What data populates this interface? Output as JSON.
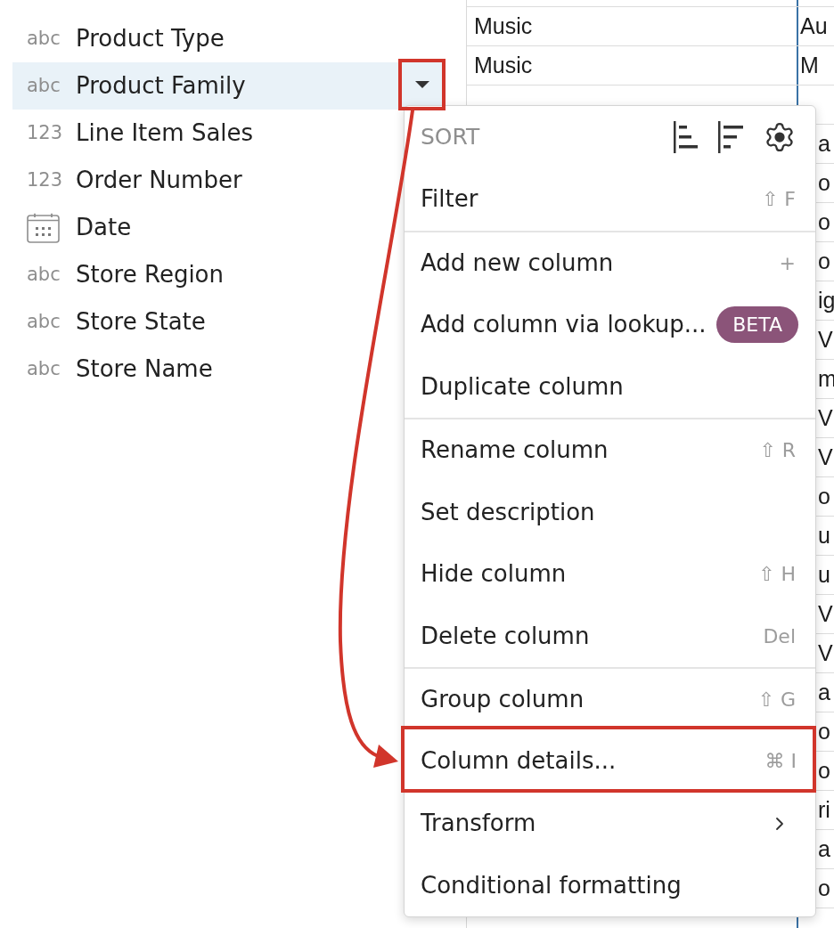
{
  "fields": [
    {
      "kind": "text",
      "type_label": "abc",
      "label": "Product Type",
      "selected": false
    },
    {
      "kind": "text",
      "type_label": "abc",
      "label": "Product Family",
      "selected": true,
      "callout": true
    },
    {
      "kind": "number",
      "type_label": "123",
      "label": "Line Item Sales",
      "selected": false
    },
    {
      "kind": "number",
      "type_label": "123",
      "label": "Order Number",
      "selected": false
    },
    {
      "kind": "date",
      "label": "Date",
      "selected": false
    },
    {
      "kind": "text",
      "type_label": "abc",
      "label": "Store Region",
      "selected": false
    },
    {
      "kind": "text",
      "type_label": "abc",
      "label": "Store State",
      "selected": false
    },
    {
      "kind": "text",
      "type_label": "abc",
      "label": "Store Name",
      "selected": false
    }
  ],
  "table": {
    "top_rows": [
      {
        "column_1": "Music",
        "column_2": "Au"
      },
      {
        "column_1": "Music",
        "column_2": "M"
      }
    ],
    "side_rows": [
      {
        "column_2": "a"
      },
      {
        "column_2": "o"
      },
      {
        "column_2": "o"
      },
      {
        "column_2": "o"
      },
      {
        "column_2": "ig"
      },
      {
        "column_2": "V"
      },
      {
        "column_2": "m"
      },
      {
        "column_2": "V"
      },
      {
        "column_2": "V"
      },
      {
        "column_2": "o"
      },
      {
        "column_2": "u"
      },
      {
        "column_2": "u"
      },
      {
        "column_2": "V"
      },
      {
        "column_2": "V"
      },
      {
        "column_2": "a"
      },
      {
        "column_2": "o"
      },
      {
        "column_2": "o"
      },
      {
        "column_2": "ri"
      },
      {
        "column_2": "a"
      },
      {
        "column_2": "o"
      }
    ]
  },
  "column_menu": {
    "sort_label": "SORT",
    "groups": [
      [
        {
          "label": "Filter",
          "shortcut": "⇧ F"
        }
      ],
      [
        {
          "label": "Add new column",
          "shortcut": "+"
        },
        {
          "label": "Add column via lookup...",
          "badge": "BETA"
        },
        {
          "label": "Duplicate column"
        }
      ],
      [
        {
          "label": "Rename column",
          "shortcut": "⇧ R"
        },
        {
          "label": "Set description"
        },
        {
          "label": "Hide column",
          "shortcut": "⇧ H"
        },
        {
          "label": "Delete column",
          "shortcut": "Del"
        }
      ],
      [
        {
          "label": "Group column",
          "shortcut": "⇧ G"
        },
        {
          "label": "Column details...",
          "shortcut": "⌘ I",
          "callout": true
        },
        {
          "label": "Transform",
          "submenu": true
        },
        {
          "label": "Conditional formatting"
        }
      ]
    ]
  }
}
